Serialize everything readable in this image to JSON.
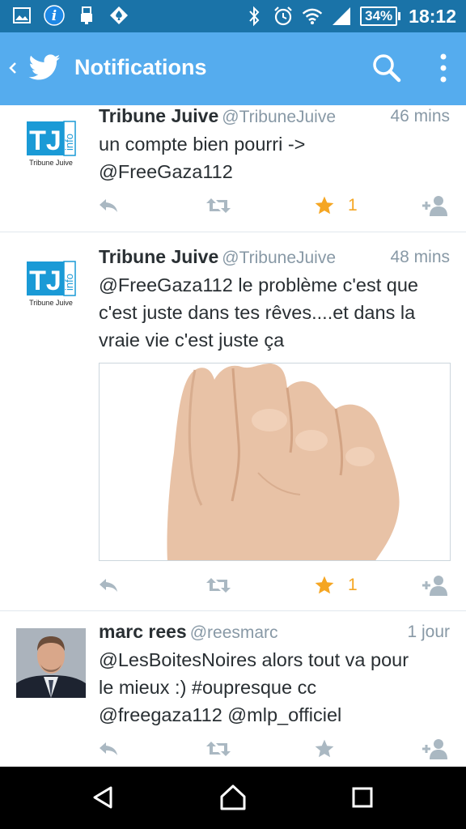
{
  "status_bar": {
    "time": "18:12",
    "battery": "34%",
    "left_icons": [
      "gallery-icon",
      "info-icon",
      "usb-icon",
      "poker-icon"
    ],
    "right_icons": [
      "bluetooth-icon",
      "alarm-icon",
      "wifi-icon",
      "signal-icon"
    ]
  },
  "app_bar": {
    "title": "Notifications",
    "color": "#55acee"
  },
  "tweets": [
    {
      "name": "Tribune Juive",
      "handle": "@TribuneJuive",
      "time": "46 mins",
      "text_lines": [
        "un compte bien pourri ->",
        "@FreeGaza112"
      ],
      "avatar": {
        "logo_main": "TJ",
        "logo_side": "info",
        "caption": "Tribune Juive"
      },
      "favorite_count": "1",
      "favorited": true
    },
    {
      "name": "Tribune Juive",
      "handle": "@TribuneJuive",
      "time": "48 mins",
      "text_lines": [
        "@FreeGaza112 le problème c'est que",
        "c'est juste dans tes rêves....et dans la",
        "vraie vie c'est juste ça"
      ],
      "avatar": {
        "logo_main": "TJ",
        "logo_side": "info",
        "caption": "Tribune Juive"
      },
      "has_image": true,
      "favorite_count": "1",
      "favorited": true
    },
    {
      "name": "marc rees",
      "handle": "@reesmarc",
      "time": "1 jour",
      "text_lines": [
        "@LesBoitesNoires alors tout va pour",
        "le mieux :) #oupresque cc",
        "@freegaza112 @mlp_officiel"
      ],
      "favorited": false
    }
  ],
  "colors": {
    "accent": "#55acee",
    "status_bar": "#1a73a8",
    "action_gray": "#aab8c2",
    "favorite": "#f5a623",
    "logo_blue": "#1a9ad6"
  }
}
